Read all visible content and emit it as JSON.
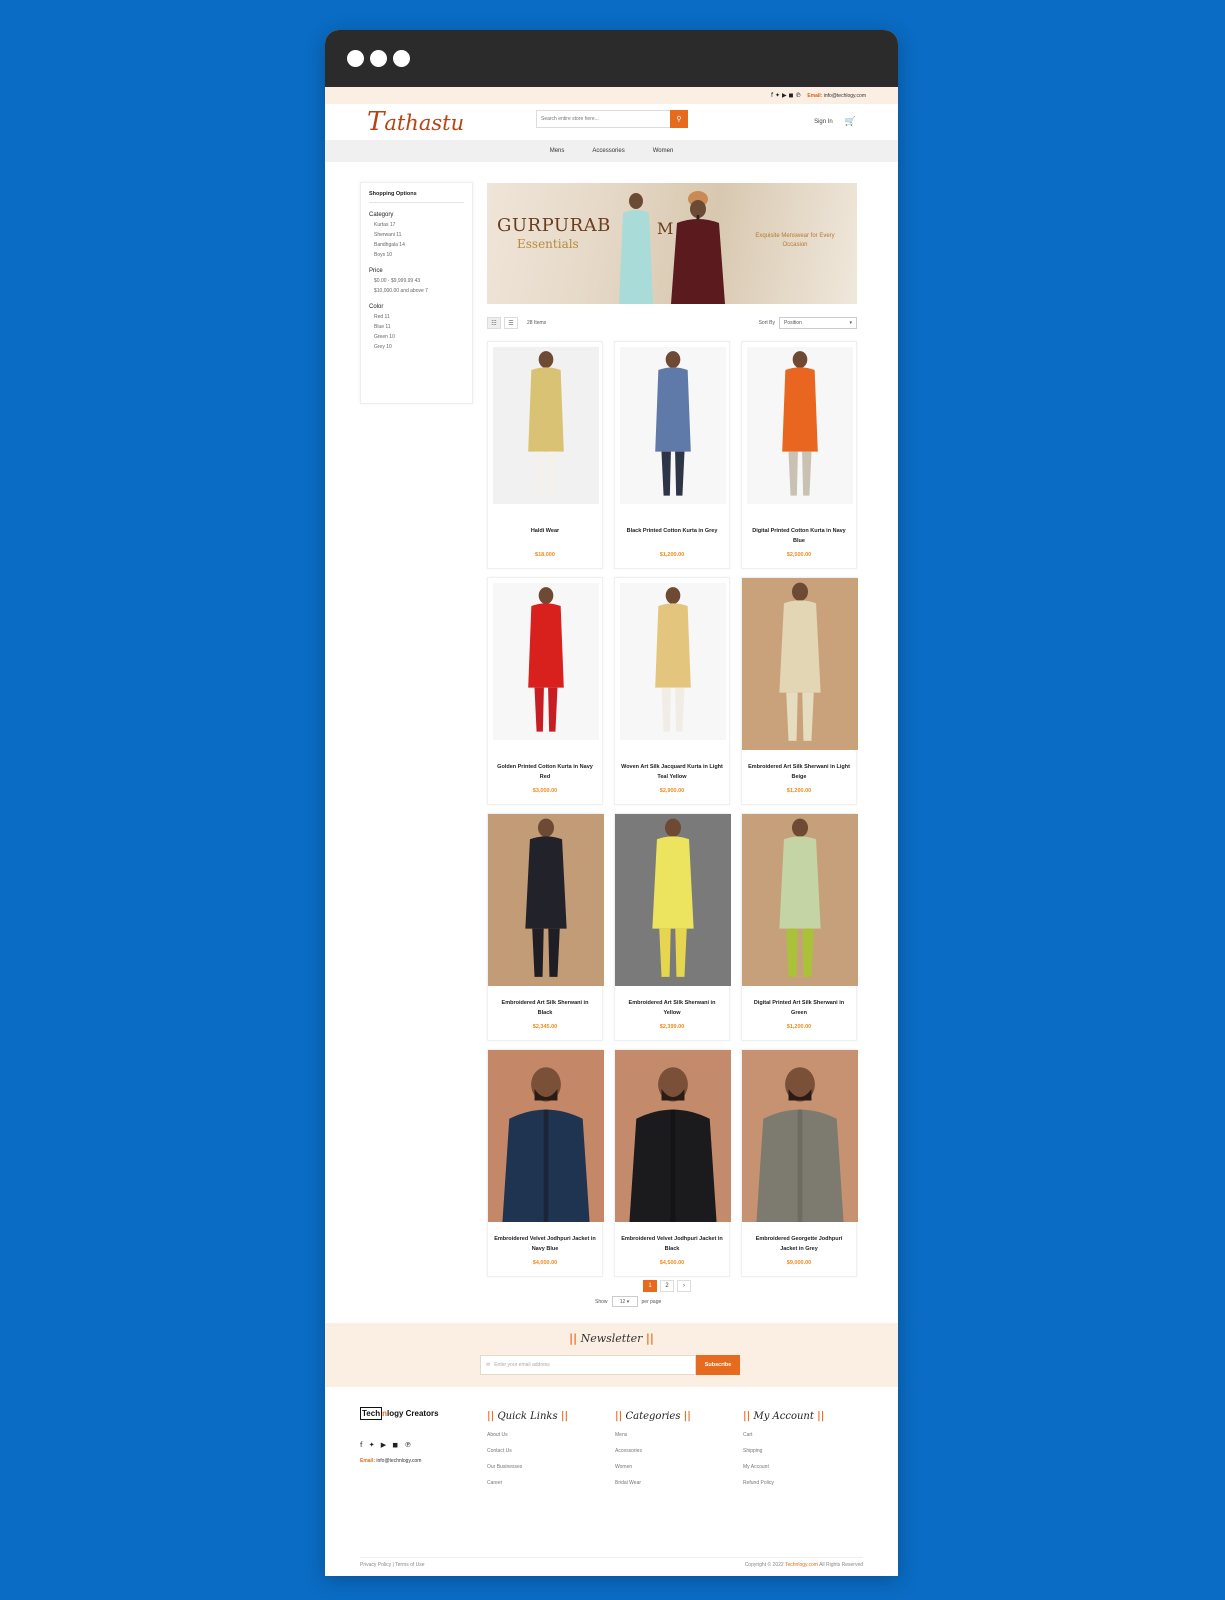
{
  "topbar": {
    "social": "f  ✦  ▶  ◼  ℗",
    "email_label": "Email:",
    "email": "info@techlogy.com"
  },
  "header": {
    "logo_initial": "T",
    "logo_rest": "athastu",
    "search_placeholder": "Search entire store here...",
    "signin": "Sign In"
  },
  "nav": [
    "Mens",
    "Accessories",
    "Women"
  ],
  "sidebar": {
    "title": "Shopping Options",
    "groups": [
      {
        "heading": "Category",
        "items": [
          "Kurtas 17",
          "Sherwani 11",
          "Bandhgala 14",
          "Boys 10"
        ]
      },
      {
        "heading": "Price",
        "items": [
          "$0.00 - $9,999.99 43",
          "$10,000.00 and above 7"
        ]
      },
      {
        "heading": "Color",
        "items": [
          "Red 11",
          "Blue 11",
          "Green 10",
          "Grey 10"
        ]
      }
    ]
  },
  "banner": {
    "title": "GURPURAB",
    "subtitle": "Essentials",
    "mid": "M",
    "tagline": "Exquisite Menswear for Every Occasion"
  },
  "toolbar": {
    "items": "28 Items",
    "sort_label": "Sort By",
    "sort_value": "Position"
  },
  "products": [
    {
      "name": "Haldi Wear",
      "price": "$18,000",
      "img": "kurta",
      "c1": "#d9c274",
      "c2": "#f4f1ec",
      "bg": "#f1f1f1"
    },
    {
      "name": "Black Printed Cotton Kurta in Grey",
      "price": "$1,200.00",
      "img": "kurta",
      "c1": "#5f79a8",
      "c2": "#2d3546",
      "bg": "#f7f7f7"
    },
    {
      "name": "Digital Printed Cotton Kurta in Navy Blue",
      "price": "$2,500.00",
      "img": "kurta",
      "c1": "#e8661f",
      "c2": "#c9c1b2",
      "bg": "#f7f7f7"
    },
    {
      "name": "Golden Printed Cotton Kurta in Navy Red",
      "price": "$3,000.00",
      "img": "kurta",
      "c1": "#d8201c",
      "c2": "#c91d24",
      "bg": "#f7f7f7"
    },
    {
      "name": "Woven Art Silk Jacquard Kurta in Light Teal Yellow",
      "price": "$2,900.00",
      "img": "kurta",
      "c1": "#e4c57e",
      "c2": "#f1ede6",
      "bg": "#f7f7f7"
    },
    {
      "name": "Embroidered Art Silk Sherwani in Light Beige",
      "price": "$1,200.00",
      "img": "sherwani",
      "c1": "#e3d6b4",
      "c2": "#e6dcc0",
      "bg": "#c9a27c"
    },
    {
      "name": "Embroidered Art Silk Sherwani in Black",
      "price": "$2,345.00",
      "img": "sherwani",
      "c1": "#22222a",
      "c2": "#1e1e24",
      "bg": "#c29b77"
    },
    {
      "name": "Embroidered Art Silk Sherwani in Yellow",
      "price": "$2,399.00",
      "img": "sherwani",
      "c1": "#ece35e",
      "c2": "#e6d64f",
      "bg": "#7a7a7a"
    },
    {
      "name": "Digital Printed Art Silk Sherwani in Green",
      "price": "$1,200.00",
      "img": "sherwani",
      "c1": "#c4d4a4",
      "c2": "#a9c23a",
      "bg": "#c6a07a"
    },
    {
      "name": "Embroidered Velvet Jodhpuri Jacket in Navy Blue",
      "price": "$4,000.00",
      "img": "jacket",
      "c1": "#1f3450",
      "c2": "#1a2638",
      "bg": "#c48868"
    },
    {
      "name": "Embroidered Velvet Jodhpuri Jacket in Black",
      "price": "$4,500.00",
      "img": "jacket",
      "c1": "#1b1b1d",
      "c2": "#141416",
      "bg": "#c48a6c"
    },
    {
      "name": "Embroidered Georgette Jodhpuri Jacket in Grey",
      "price": "$9,000.00",
      "img": "jacket",
      "c1": "#7d7a70",
      "c2": "#6e6b62",
      "bg": "#c69272"
    }
  ],
  "pagination": {
    "pages": [
      "1",
      "2",
      "›"
    ],
    "show_label": "Show",
    "show_value": "12",
    "per_page": "per page"
  },
  "newsletter": {
    "title": "Newsletter",
    "placeholder": "Enter your email address",
    "button": "Subscribe"
  },
  "footer": {
    "brand_a": "Tech",
    "brand_o": "n",
    "brand_b": "logy Creators",
    "social": "f ✦ ▶ ◼ ℗",
    "email_label": "Email:",
    "email": "info@technlogy.com",
    "columns": [
      {
        "title": "Quick Links",
        "links": [
          "About Us",
          "Contact Us",
          "Our Businesses",
          "Career"
        ]
      },
      {
        "title": "Categories",
        "links": [
          "Mens",
          "Accessories",
          "Women",
          "Bridal Wear"
        ]
      },
      {
        "title": "My Account",
        "links": [
          "Cart",
          "Shipping",
          "My Account",
          "Refund Policy"
        ]
      }
    ],
    "bottom_left": "Privacy Policy | Terms of Use",
    "copy_a": "Copyright © 2022",
    "copy_o": "Technlogy.com",
    "copy_b": "All Rights Reserved"
  },
  "colors": {
    "accent": "#e66b1f",
    "price": "#f28a1e",
    "page_bg": "#0a6cc4"
  }
}
